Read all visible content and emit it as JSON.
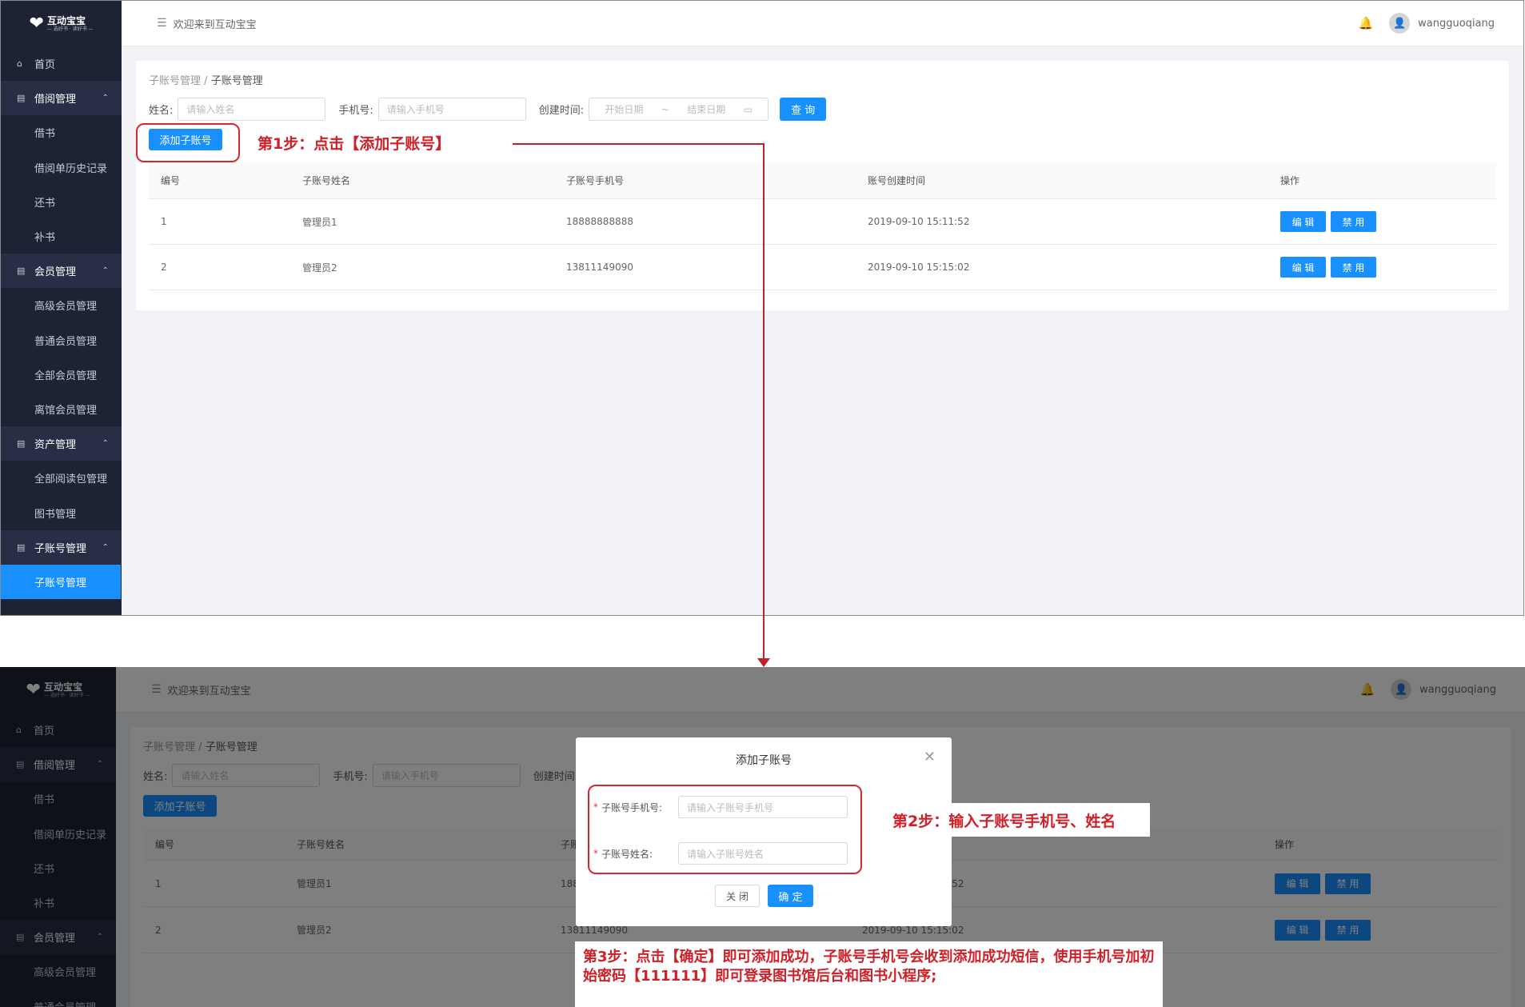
{
  "app": {
    "brand": "互动宝宝",
    "slogan": "— 选好书 · 读好书 —",
    "welcome": "欢迎来到互动宝宝",
    "username": "wangguoqiang"
  },
  "sidebar": [
    {
      "label": "首页",
      "type": "top",
      "icon": "home-icon"
    },
    {
      "label": "借阅管理",
      "type": "group",
      "icon": "book-icon"
    },
    {
      "label": "借书",
      "type": "sub"
    },
    {
      "label": "借阅单历史记录",
      "type": "sub"
    },
    {
      "label": "还书",
      "type": "sub"
    },
    {
      "label": "补书",
      "type": "sub"
    },
    {
      "label": "会员管理",
      "type": "group",
      "icon": "users-icon"
    },
    {
      "label": "高级会员管理",
      "type": "sub"
    },
    {
      "label": "普通会员管理",
      "type": "sub"
    },
    {
      "label": "全部会员管理",
      "type": "sub"
    },
    {
      "label": "离馆会员管理",
      "type": "sub"
    },
    {
      "label": "资产管理",
      "type": "group",
      "icon": "asset-icon"
    },
    {
      "label": "全部阅读包管理",
      "type": "sub"
    },
    {
      "label": "图书管理",
      "type": "sub"
    },
    {
      "label": "子账号管理",
      "type": "group",
      "icon": "account-icon"
    },
    {
      "label": "子账号管理",
      "type": "sub",
      "active": true
    }
  ],
  "breadcrumb": {
    "parent": "子账号管理",
    "sep": "/",
    "current": "子账号管理"
  },
  "filters": {
    "name_label": "姓名:",
    "name_placeholder": "请输入姓名",
    "phone_label": "手机号:",
    "phone_placeholder": "请输入手机号",
    "date_label": "创建时间:",
    "start_placeholder": "开始日期",
    "range_sep": "~",
    "end_placeholder": "结束日期",
    "query_button": "查 询"
  },
  "add_button": "添加子账号",
  "table": {
    "headers": [
      "编号",
      "子账号姓名",
      "子账号手机号",
      "账号创建时间",
      "操作"
    ],
    "rows": [
      [
        "1",
        "管理员1",
        "18888888888",
        "2019-09-10 15:11:52"
      ],
      [
        "2",
        "管理员2",
        "13811149090",
        "2019-09-10 15:15:02"
      ]
    ],
    "edit_label": "编 辑",
    "disable_label": "禁 用"
  },
  "dialog": {
    "title": "添加子账号",
    "phone_label": "子账号手机号:",
    "phone_placeholder": "请输入子账号手机号",
    "name_label": "子账号姓名:",
    "name_placeholder": "请输入子账号姓名",
    "close_button": "关 闭",
    "confirm_button": "确 定"
  },
  "annotations": {
    "step1": "第1步：点击【添加子账号】",
    "step2": "第2步：输入子账号手机号、姓名",
    "step3": "第3步：点击【确定】即可添加成功，子账号手机号会收到添加成功短信，使用手机号加初始密码【111111】即可登录图书馆后台和图书小程序;"
  },
  "colors": {
    "primary": "#1890ff",
    "sidebar": "#1d2235",
    "annotation_red": "#d01f27"
  }
}
